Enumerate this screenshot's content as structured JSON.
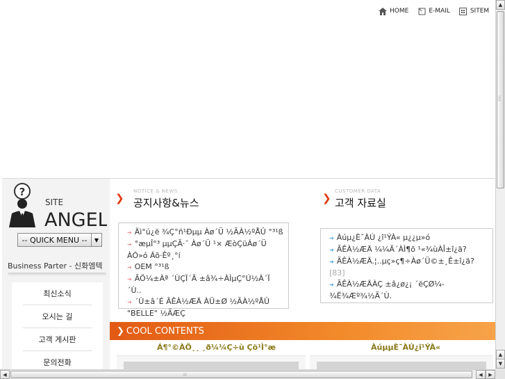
{
  "topnav": {
    "home": {
      "label": "HOME",
      "icon": "home-icon"
    },
    "email": {
      "label": "E-MAIL",
      "icon": "email-icon"
    },
    "sitemap": {
      "label": "SITEM",
      "icon": "sitemap-icon"
    }
  },
  "sidebar": {
    "logo": {
      "top": "SITE",
      "bottom": "ANGEL"
    },
    "quick_menu": "-- QUICK MENU --",
    "partner": "Business Parter - 신화엠텍",
    "menu": [
      "최신소식",
      "오시는 길",
      "고객 게시판",
      "문의전화"
    ]
  },
  "notice": {
    "subtitle": "NOTICE & NEWS",
    "title": "공지사항&뉴스",
    "items": [
      "Äì°ú¿ë ¾Ç°ñ¹Ðµµ Àø´Ü ½ÃÀ½ºÅÛ °³¹ß",
      "°æµÎ°³ µµÇÃ·¯ Àø´Ü ¹× ÆòÇüÁø´Ü ÀÓ»ó Áõ·Êº¸°í",
      "OEM °³¹ß",
      "ÃÖ¼±Àª ´ÙÇÏ´Â ±â¾÷ÀÌµÇ°Ú½À´Ï´Ù..",
      "´Ù±â´É ÃÊÀ½ÆÄ ÀÜ±Ø ½ÃÀ½ºÅÛ \"BELLE\" ½ÃÆÇ"
    ]
  },
  "customer": {
    "subtitle": "CUSTOMER DATA",
    "title": "고객 자료실",
    "items": [
      "Àúµ¿È¯ÀÚ ¿î¹ÝÀ« µ¿¿µ»ó",
      "ÃÊÀ½ÆÄ ¼¼Ã´ÀÌ¶õ ¹«¾ùÀÎ±î¿ä?",
      "ÃÊÀ½ÆÄ.¦..µç»ç¶÷Àø´Ü©±¸Ê±î¿ä?",
      "ÃÊÀ½ÆÄÀÇ ±â¿ø¿¡ ´ëÇØ¼­ ¾Ë¾Æº¾½Ã´Ù."
    ],
    "count": "[83]"
  },
  "cool": {
    "label": "COOL CONTENTS",
    "left_title": "Á¶°©ÀÖ¸¸ ¸ð¼¼Ç÷ù Çö¹Ì°æ",
    "right_title": "ÀúµµÈ¯ÀÚ¿î¹ÝÀ«"
  },
  "colors": {
    "accent": "#e03a10",
    "cool_bar": "#f28a2a",
    "olive": "#8a7a1a",
    "sidebar_bg": "#f3f3f3"
  }
}
